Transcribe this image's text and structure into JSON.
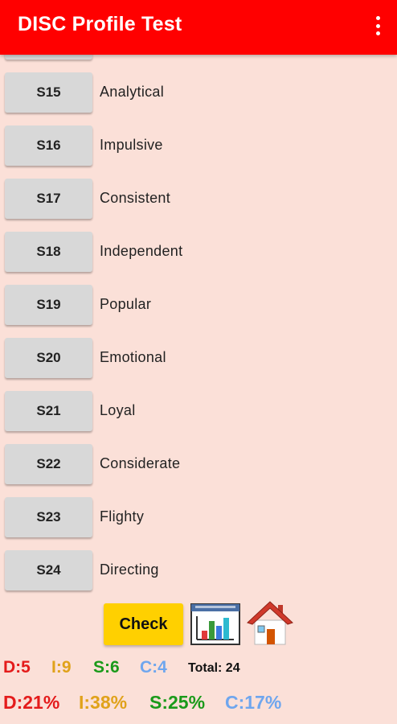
{
  "appbar": {
    "title": "DISC Profile Test",
    "menu_icon": "more-vert-icon"
  },
  "statements": [
    {
      "code": "S15",
      "label": "Analytical"
    },
    {
      "code": "S16",
      "label": "Impulsive"
    },
    {
      "code": "S17",
      "label": "Consistent"
    },
    {
      "code": "S18",
      "label": "Independent"
    },
    {
      "code": "S19",
      "label": "Popular"
    },
    {
      "code": "S20",
      "label": "Emotional"
    },
    {
      "code": "S21",
      "label": "Loyal"
    },
    {
      "code": "S22",
      "label": "Considerate"
    },
    {
      "code": "S23",
      "label": "Flighty"
    },
    {
      "code": "S24",
      "label": "Directing"
    }
  ],
  "actions": {
    "check_label": "Check",
    "chart_icon": "bar-chart-icon",
    "home_icon": "home-icon"
  },
  "scores": {
    "d": "D:5",
    "i": "I:9",
    "s": "S:6",
    "c": "C:4",
    "total": "Total: 24"
  },
  "percentages": {
    "d": "D:21%",
    "i": "I:38%",
    "s": "S:25%",
    "c": "C:17%"
  },
  "colors": {
    "appbar": "#ff0000",
    "background": "#fbe0d8",
    "check_button": "#ffd000",
    "d": "#e41b1b",
    "i": "#e0a21a",
    "s": "#1a9a1a",
    "c": "#6fa6ee"
  }
}
